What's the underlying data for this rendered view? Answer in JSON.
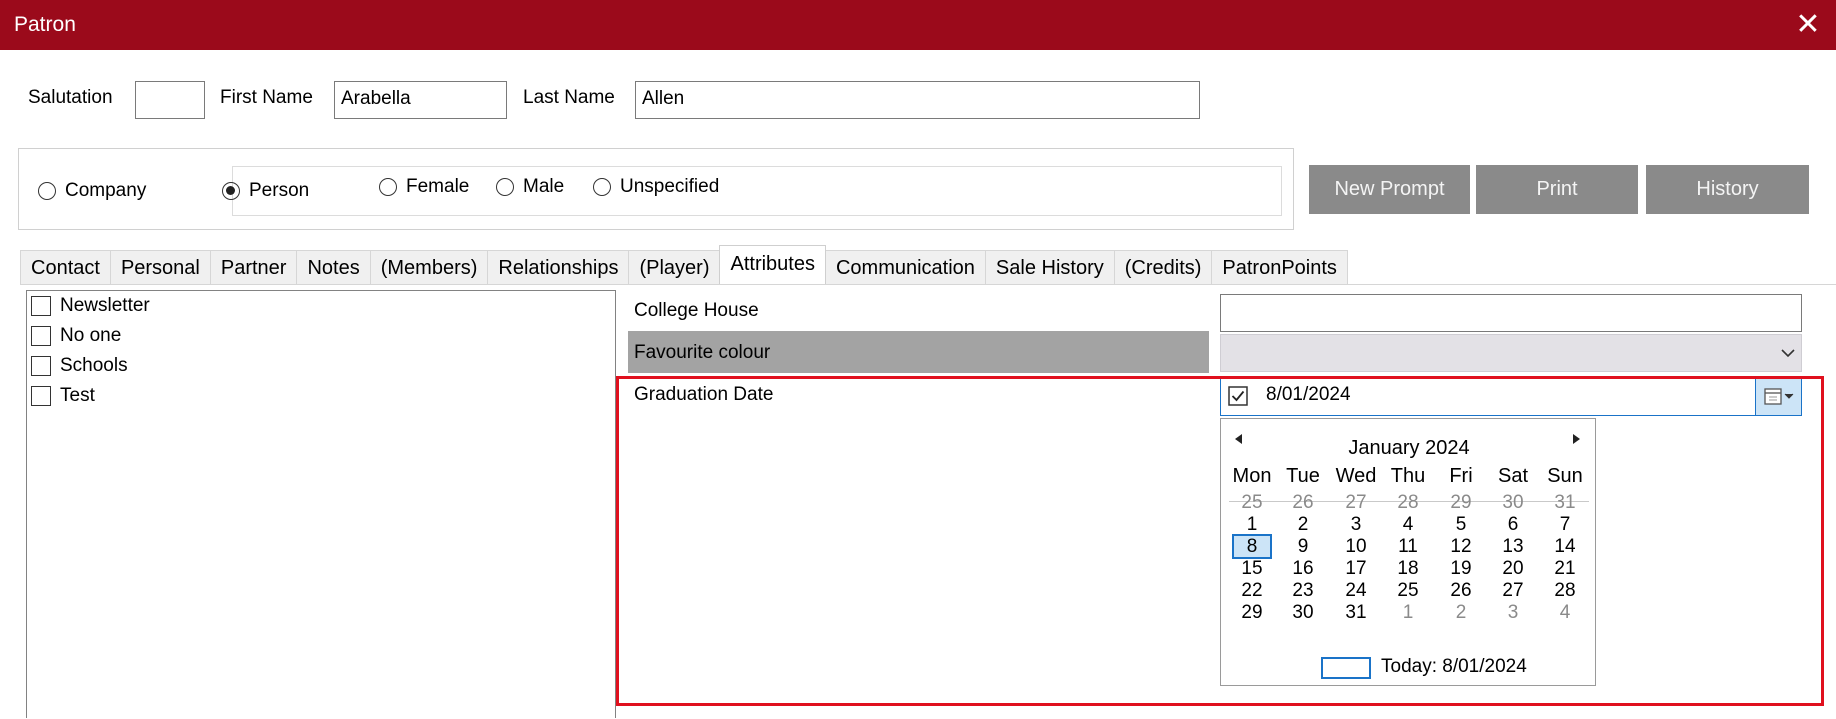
{
  "window": {
    "title": "Patron",
    "close_glyph": "✕"
  },
  "name": {
    "salutation_label": "Salutation",
    "salutation_value": "",
    "first_label": "First Name",
    "first_value": "Arabella",
    "last_label": "Last Name",
    "last_value": "Allen"
  },
  "type": {
    "company": "Company",
    "person": "Person",
    "selected": "Person",
    "gender": {
      "female": "Female",
      "male": "Male",
      "unspecified": "Unspecified"
    }
  },
  "buttons": {
    "new_prompt": "New Prompt",
    "print": "Print",
    "history": "History"
  },
  "tabs": [
    {
      "label": "Contact"
    },
    {
      "label": "Personal"
    },
    {
      "label": "Partner"
    },
    {
      "label": "Notes"
    },
    {
      "label": "(Members)"
    },
    {
      "label": "Relationships"
    },
    {
      "label": "(Player)"
    },
    {
      "label": "Attributes"
    },
    {
      "label": "Communication"
    },
    {
      "label": "Sale History"
    },
    {
      "label": "(Credits)"
    },
    {
      "label": "PatronPoints"
    }
  ],
  "active_tab": "Attributes",
  "checklist": [
    {
      "label": "Newsletter",
      "checked": false
    },
    {
      "label": "No one",
      "checked": false
    },
    {
      "label": "Schools",
      "checked": false
    },
    {
      "label": "Test",
      "checked": false
    }
  ],
  "attributes": {
    "college_house_label": "College House",
    "college_house_value": "",
    "favourite_colour_label": "Favourite colour",
    "favourite_colour_value": "",
    "graduation_date_label": "Graduation Date",
    "graduation_date_value": "8/01/2024",
    "graduation_date_checked": true
  },
  "calendar": {
    "month_title": "January 2024",
    "weekdays": [
      "Mon",
      "Tue",
      "Wed",
      "Thu",
      "Fri",
      "Sat",
      "Sun"
    ],
    "weeks": [
      [
        "25",
        "26",
        "27",
        "28",
        "29",
        "30",
        "31"
      ],
      [
        "1",
        "2",
        "3",
        "4",
        "5",
        "6",
        "7"
      ],
      [
        "8",
        "9",
        "10",
        "11",
        "12",
        "13",
        "14"
      ],
      [
        "15",
        "16",
        "17",
        "18",
        "19",
        "20",
        "21"
      ],
      [
        "22",
        "23",
        "24",
        "25",
        "26",
        "27",
        "28"
      ],
      [
        "29",
        "30",
        "31",
        "1",
        "2",
        "3",
        "4"
      ]
    ],
    "selected_day": "8",
    "today_label": "Today: 8/01/2024"
  },
  "colors": {
    "titlebar": "#9b0a1b",
    "button": "#8a8a8a",
    "highlight": "#e0101e",
    "disabled_field": "#a3a3a3"
  }
}
